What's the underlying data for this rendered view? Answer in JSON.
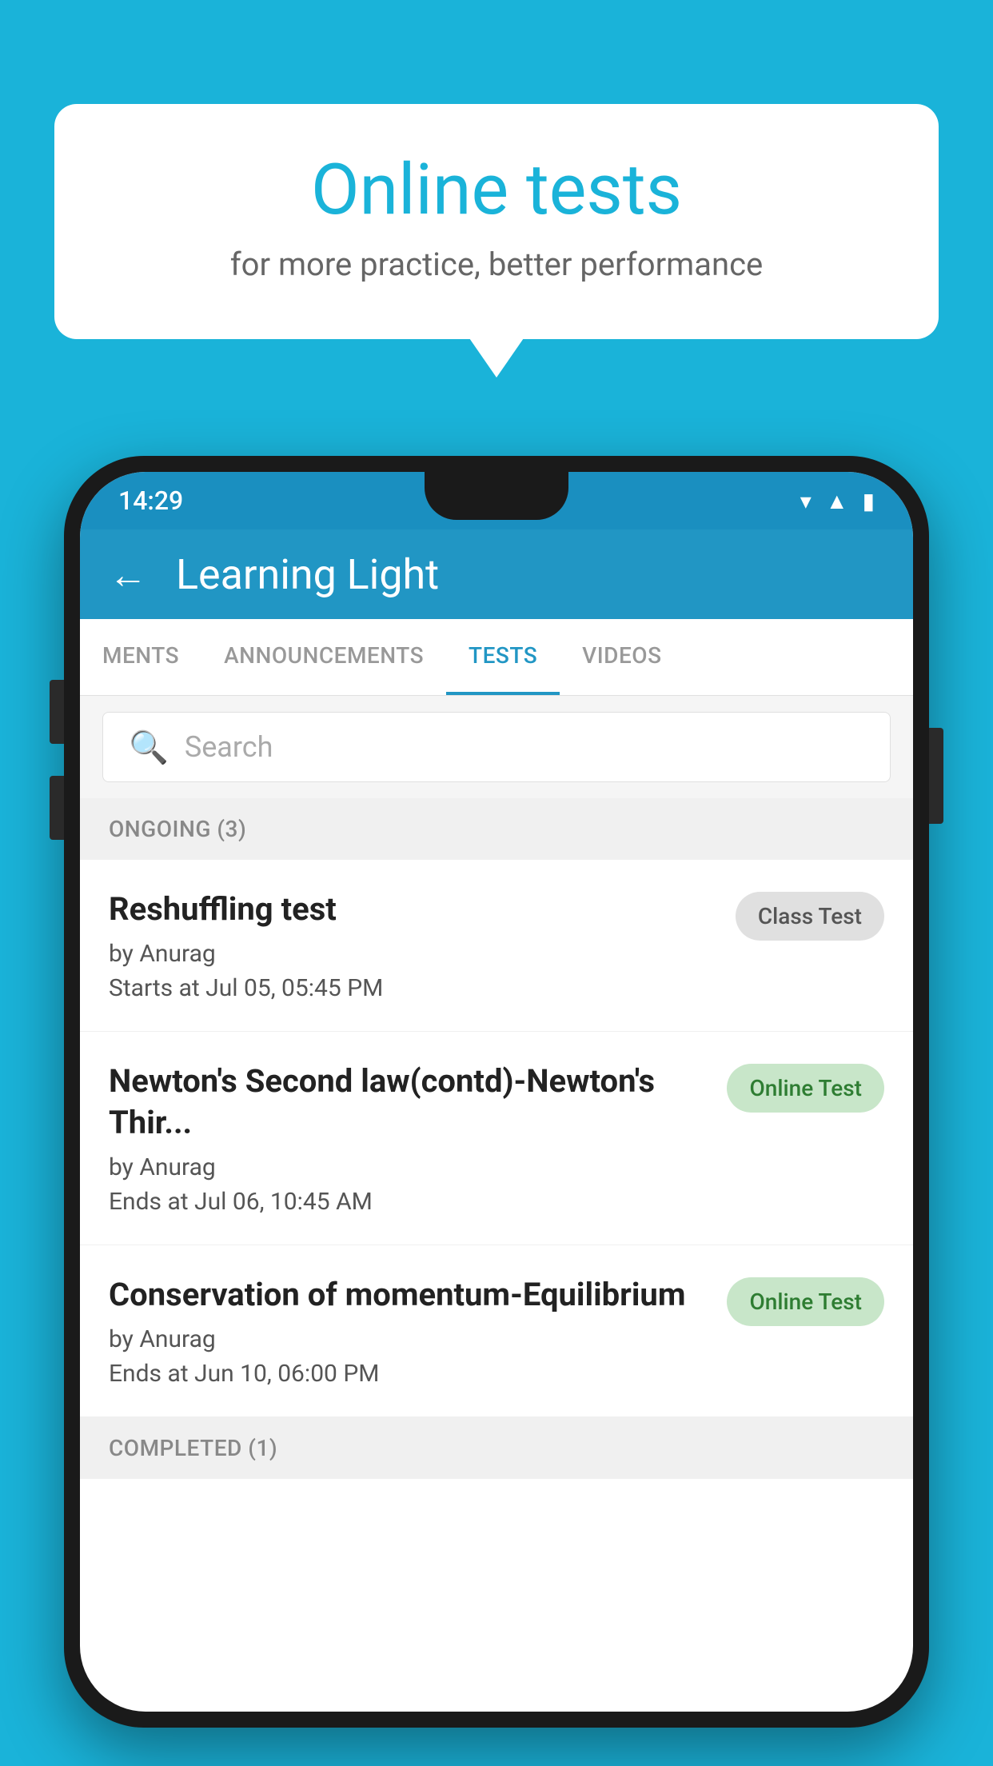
{
  "background_color": "#1ab3d9",
  "speech_bubble": {
    "title": "Online tests",
    "subtitle": "for more practice, better performance"
  },
  "phone": {
    "status_bar": {
      "time": "14:29",
      "icons": [
        "wifi",
        "signal",
        "battery"
      ]
    },
    "app_bar": {
      "title": "Learning Light",
      "back_label": "←"
    },
    "tabs": [
      {
        "label": "MENTS",
        "active": false
      },
      {
        "label": "ANNOUNCEMENTS",
        "active": false
      },
      {
        "label": "TESTS",
        "active": true
      },
      {
        "label": "VIDEOS",
        "active": false
      }
    ],
    "search": {
      "placeholder": "Search"
    },
    "section_ongoing": {
      "label": "ONGOING (3)"
    },
    "tests": [
      {
        "title": "Reshuffling test",
        "author": "by Anurag",
        "date": "Starts at  Jul 05, 05:45 PM",
        "badge": "Class Test",
        "badge_type": "gray"
      },
      {
        "title": "Newton's Second law(contd)-Newton's Thir...",
        "author": "by Anurag",
        "date": "Ends at  Jul 06, 10:45 AM",
        "badge": "Online Test",
        "badge_type": "green"
      },
      {
        "title": "Conservation of momentum-Equilibrium",
        "author": "by Anurag",
        "date": "Ends at  Jun 10, 06:00 PM",
        "badge": "Online Test",
        "badge_type": "green"
      }
    ],
    "section_completed": {
      "label": "COMPLETED (1)"
    }
  }
}
